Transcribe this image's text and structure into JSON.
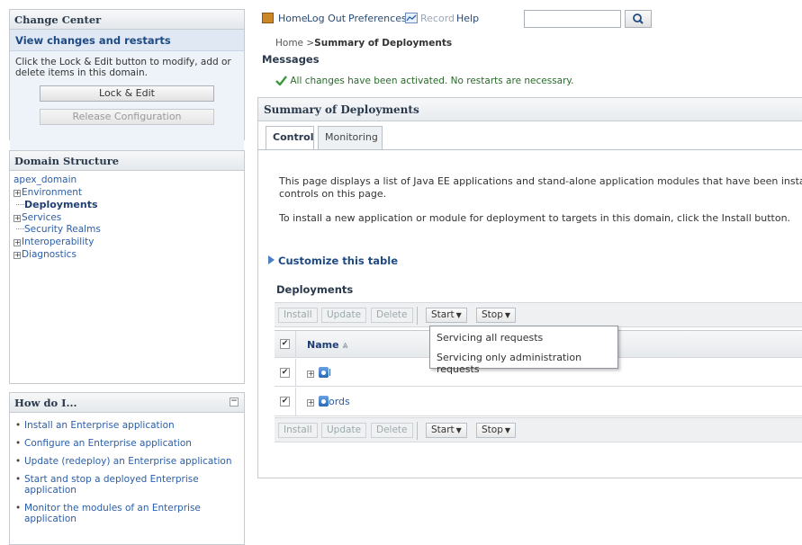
{
  "change_center": {
    "title": "Change Center",
    "subtitle": "View changes and restarts",
    "description": "Click the Lock & Edit button to modify, add or delete items in this domain.",
    "lock_edit_label": "Lock & Edit",
    "release_label": "Release Configuration"
  },
  "domain_structure": {
    "title": "Domain Structure",
    "root": "apex_domain",
    "items": [
      "Environment",
      "Deployments",
      "Services",
      "Security Realms",
      "Interoperability",
      "Diagnostics"
    ]
  },
  "how_do_i": {
    "title": "How do I...",
    "collapse": "−",
    "items": [
      "Install an Enterprise application",
      "Configure an Enterprise application",
      "Update (redeploy) an Enterprise application",
      "Start and stop a deployed Enterprise application",
      "Monitor the modules of an Enterprise application"
    ]
  },
  "topbar": {
    "home": "Home",
    "logout": "Log Out",
    "preferences": "Preferences",
    "record": "Record",
    "help": "Help",
    "search_placeholder": ""
  },
  "breadcrumb": {
    "home": "Home >",
    "current": "Summary of Deployments"
  },
  "messages": {
    "title": "Messages",
    "success": "All changes have been activated. No restarts are necessary."
  },
  "summary": {
    "title": "Summary of Deployments",
    "tabs": [
      "Control",
      "Monitoring"
    ],
    "para1_line1": "This page displays a list of Java EE applications and stand-alone application modules that have been installed to",
    "para1_line2": "controls on this page.",
    "para2": "To install a new application or module for deployment to targets in this domain, click the Install button.",
    "customize": "Customize this table",
    "deployments_title": "Deployments"
  },
  "table_toolbar": {
    "install": "Install",
    "update": "Update",
    "delete": "Delete",
    "start": "Start",
    "stop": "Stop"
  },
  "table": {
    "name_header": "Name",
    "sort_icon": "⩓",
    "rows": [
      {
        "name": "l"
      },
      {
        "name": "ords"
      }
    ]
  },
  "start_menu": {
    "items": [
      "Servicing all requests",
      "Servicing only administration requests"
    ]
  },
  "colors": {
    "link": "#2a5eaa",
    "panel_header": "#e4e8ec",
    "success": "#3a9a3a"
  }
}
